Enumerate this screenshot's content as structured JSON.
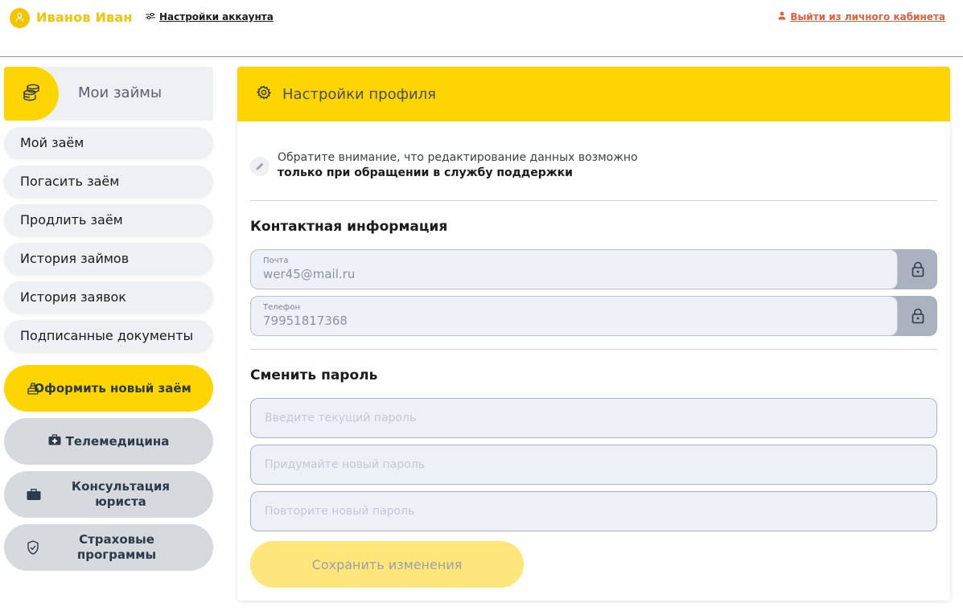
{
  "header": {
    "user_name": "Иванов Иван",
    "settings_link": "Настройки аккаунта",
    "logout_link": "Выйти из личного кабинета"
  },
  "sidebar": {
    "loans_title": "Мои займы",
    "items": [
      {
        "label": "Мой заём"
      },
      {
        "label": "Погасить заём"
      },
      {
        "label": "Продлить заём"
      },
      {
        "label": "История займов"
      },
      {
        "label": "История заявок"
      },
      {
        "label": "Подписанные документы"
      }
    ],
    "new_loan": "Оформить новый заём",
    "telemedicine": "Телемедицина",
    "lawyer": "Консультация юриста",
    "insurance": "Страховые программы"
  },
  "main": {
    "title": "Настройки профиля",
    "notice_line1": "Обратите внимание, что редактирование данных возможно",
    "notice_line2": "только при обращении в службу поддержки",
    "contact_title": "Контактная информация",
    "email_label": "Почта",
    "email_value": "wer45@mail.ru",
    "phone_label": "Телефон",
    "phone_value": "79951817368",
    "password_title": "Сменить пароль",
    "current_password_placeholder": "Введите текущий пароль",
    "new_password_placeholder": "Придумайте новый пароль",
    "repeat_password_placeholder": "Повторите новый пароль",
    "save_label": "Сохранить изменения"
  },
  "colors": {
    "accent": "#ffd500",
    "brand_text": "#f5c400",
    "logout": "#e0603e",
    "nav_bg": "#eef0f4",
    "grey_button": "#d6d9de"
  },
  "icons": {
    "avatar": "user-icon",
    "settings": "sliders-icon",
    "logout": "person-icon",
    "loans": "coins-icon",
    "card_header": "gear-icon",
    "notice": "pencil-icon",
    "lock": "lock-icon",
    "new_loan": "hand-coins-icon",
    "telemedicine": "medical-kit-icon",
    "lawyer": "briefcase-icon",
    "insurance": "shield-check-icon"
  }
}
